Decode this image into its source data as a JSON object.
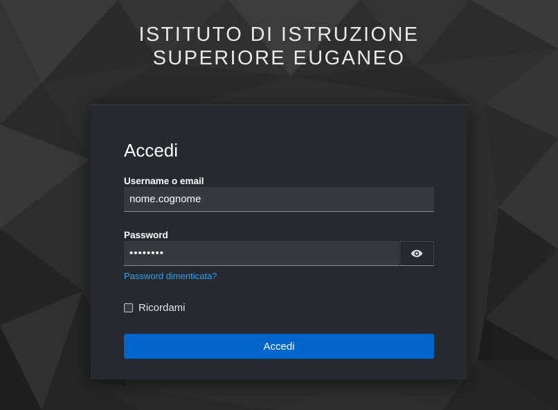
{
  "realm": {
    "title_line1": "ISTITUTO DI ISTRUZIONE",
    "title_line2": "SUPERIORE EUGANEO"
  },
  "login": {
    "heading": "Accedi",
    "username_label": "Username o email",
    "username_value": "nome.cognome",
    "password_label": "Password",
    "password_value": "••••••••",
    "show_password_icon": "eye-icon",
    "forgot_password": "Password dimenticata?",
    "remember_me": "Ricordami",
    "remember_checked": false,
    "submit_label": "Accedi"
  },
  "colors": {
    "background": "#2f2f2f",
    "card": "#26292d",
    "input": "#36393d",
    "primary_button": "#0066cc",
    "link": "#2ea3f2"
  }
}
